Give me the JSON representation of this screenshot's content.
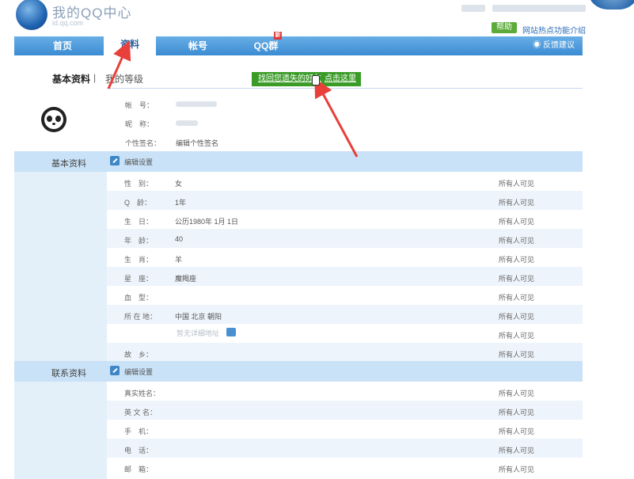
{
  "header": {
    "logo_text": "我的QQ中心",
    "logo_sub": "id.qq.com",
    "help_label": "帮助",
    "hot_link": "网站热点功能介绍"
  },
  "nav": {
    "home": "首页",
    "profile": "资料",
    "account": "帐号",
    "qqgroup": "QQ群",
    "new_badge": "新",
    "feedback": "反馈建议"
  },
  "subnav": {
    "basic": "基本资料",
    "separator": "|",
    "level": "我的等级",
    "recover_left": "找回您遗失的好友",
    "recover_right": "点击这里"
  },
  "top_info": {
    "account_label": "帐　号：",
    "nickname_label": "昵　称：",
    "signature_label": "个性签名：",
    "signature_value": "编辑个性签名"
  },
  "basic_section": {
    "title": "基本资料",
    "edit": "编辑设置",
    "rows": [
      {
        "label": "性　别：",
        "value": "女",
        "scope": "所有人可见"
      },
      {
        "label": "Q　龄：",
        "value": "1年",
        "scope": "所有人可见"
      },
      {
        "label": "生　日：",
        "value": "公历1980年 1月 1日",
        "scope": "所有人可见"
      },
      {
        "label": "年　龄：",
        "value": "40",
        "scope": "所有人可见"
      },
      {
        "label": "生　肖：",
        "value": "羊",
        "scope": "所有人可见"
      },
      {
        "label": "星　座：",
        "value": "魔羯座",
        "scope": "所有人可见"
      },
      {
        "label": "血　型：",
        "value": "",
        "scope": "所有人可见"
      },
      {
        "label": "所 在 地：",
        "value": "中国  北京  朝阳",
        "scope": "所有人可见"
      },
      {
        "label": "",
        "value": "",
        "scope": "所有人可见"
      },
      {
        "label": "故　乡：",
        "value": "",
        "scope": "所有人可见"
      }
    ],
    "detail_placeholder": "暂无详细地址"
  },
  "contact_section": {
    "title": "联系资料",
    "edit": "编辑设置",
    "rows": [
      {
        "label": "真实姓名：",
        "value": "",
        "scope": "所有人可见"
      },
      {
        "label": "英 文 名：",
        "value": "",
        "scope": "所有人可见"
      },
      {
        "label": "手　机：",
        "value": "",
        "scope": "所有人可见"
      },
      {
        "label": "电　话：",
        "value": "",
        "scope": "所有人可见"
      },
      {
        "label": "邮　箱：",
        "value": "",
        "scope": "所有人可见"
      }
    ]
  },
  "colors": {
    "nav": "#3b8bd2",
    "section": "#c9e2f7",
    "recover": "#3a9c27",
    "arrow": "#e8403a"
  },
  "icons": [
    "logo-icon",
    "panda-avatar-icon",
    "edit-icon",
    "map-icon",
    "feedback-icon",
    "cursor-icon"
  ]
}
